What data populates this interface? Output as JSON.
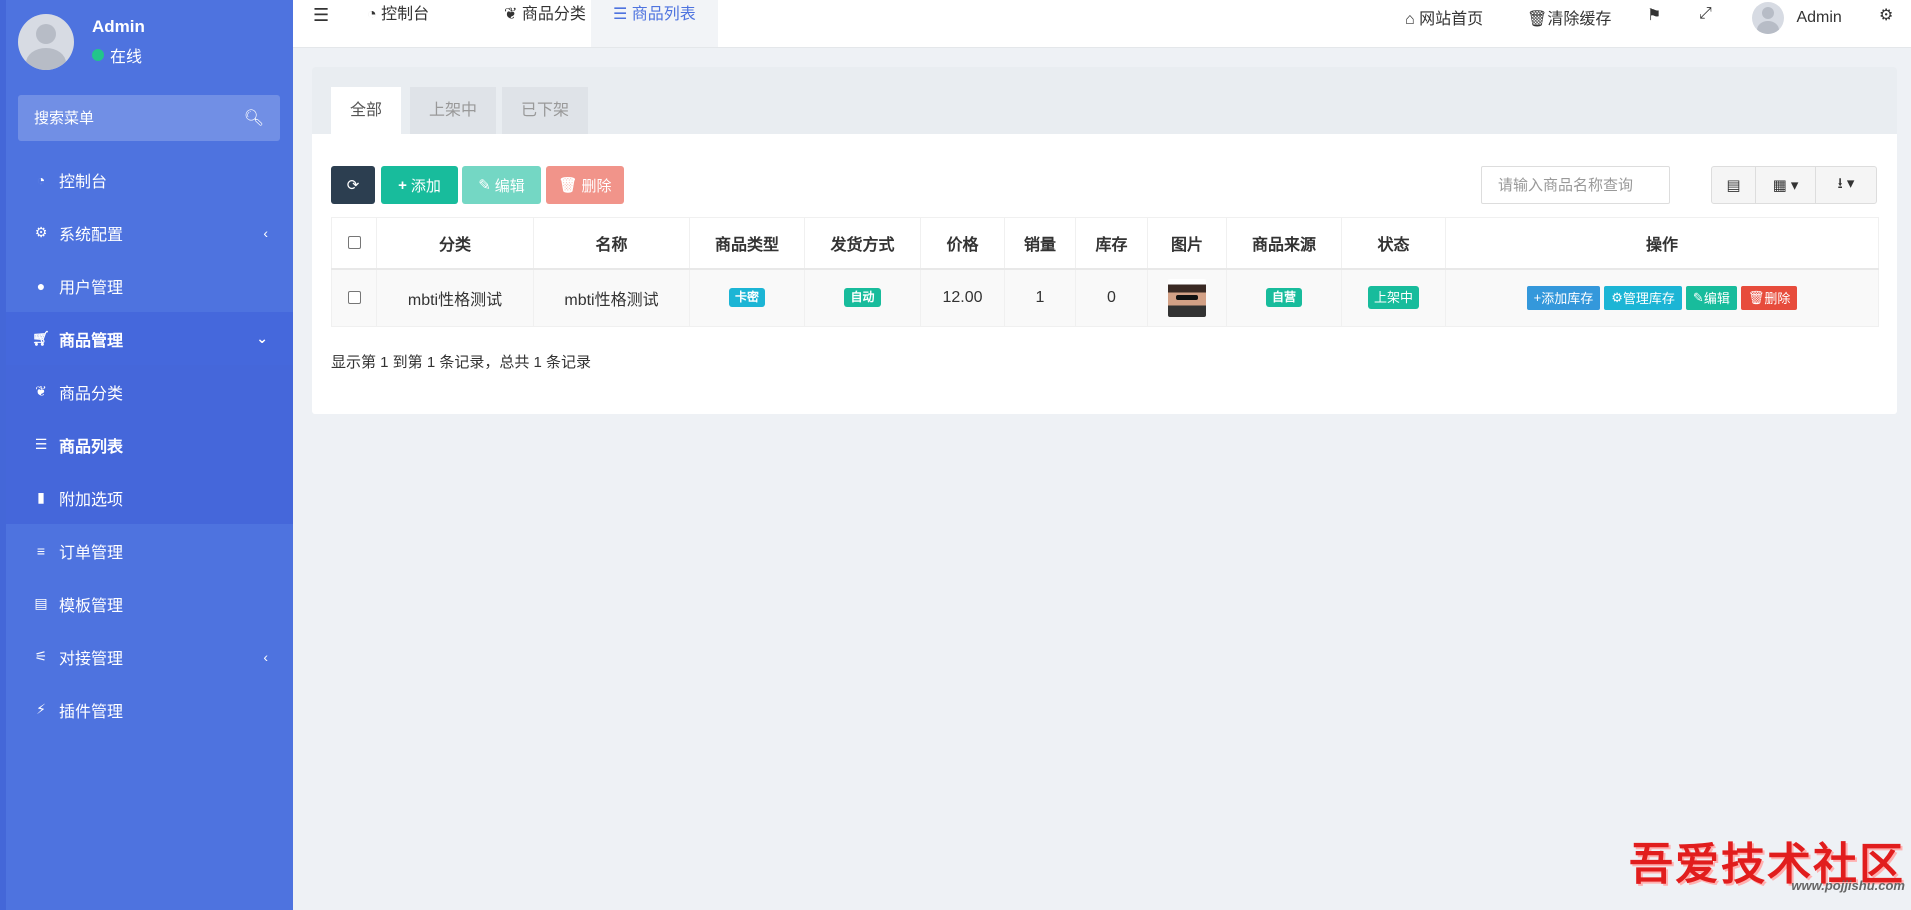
{
  "sidebar": {
    "user": {
      "name": "Admin",
      "status": "在线"
    },
    "search_placeholder": "搜索菜单",
    "items": [
      {
        "icon": "dashboard-icon",
        "glyph": "⌚",
        "label": "控制台"
      },
      {
        "icon": "gear-icon",
        "glyph": "⚙",
        "label": "系统配置",
        "caret": "‹"
      },
      {
        "icon": "user-icon",
        "glyph": "👤",
        "label": "用户管理"
      },
      {
        "icon": "cart-icon",
        "glyph": "🛒",
        "label": "商品管理",
        "caret": "⌄"
      },
      {
        "icon": "leaf-icon",
        "glyph": "❦",
        "label": "商品分类"
      },
      {
        "icon": "list-icon",
        "glyph": "☰",
        "label": "商品列表"
      },
      {
        "icon": "bookmark-icon",
        "glyph": "🔖",
        "label": "附加选项"
      },
      {
        "icon": "menu-icon",
        "glyph": "≡",
        "label": "订单管理"
      },
      {
        "icon": "template-icon",
        "glyph": "▤",
        "label": "模板管理"
      },
      {
        "icon": "sliders-icon",
        "glyph": "⚟",
        "label": "对接管理",
        "caret": "‹"
      },
      {
        "icon": "plug-icon",
        "glyph": "🔌",
        "label": "插件管理"
      }
    ]
  },
  "header": {
    "tabs": [
      "控制台",
      "商品分类",
      "商品列表"
    ],
    "links": {
      "home": "网站首页",
      "clear_cache": "清除缓存",
      "user": "Admin"
    }
  },
  "panel": {
    "tabs": [
      "全部",
      "上架中",
      "已下架"
    ],
    "toolbar": {
      "add": "添加",
      "edit": "编辑",
      "delete": "删除"
    },
    "search_placeholder": "请输入商品名称查询",
    "columns": [
      "分类",
      "名称",
      "商品类型",
      "发货方式",
      "价格",
      "销量",
      "库存",
      "图片",
      "商品来源",
      "状态",
      "操作"
    ],
    "rows": [
      {
        "category": "mbti性格测试",
        "name": "mbti性格测试",
        "type": "卡密",
        "delivery": "自动",
        "price": "12.00",
        "sales": "1",
        "stock": "0",
        "source": "自营",
        "status": "上架中",
        "ops": [
          "添加库存",
          "管理库存",
          "编辑",
          "删除"
        ]
      }
    ],
    "pagination": "显示第 1 到第 1 条记录，总共 1 条记录"
  },
  "colors": {
    "sidebar": "#4e73df",
    "primary": "#4e73df",
    "success": "#18bc9c",
    "info": "#1cb5d5",
    "danger": "#e74c3c",
    "dark": "#2c3e50",
    "blue": "#3498db"
  },
  "watermark": {
    "text": "吾爱技术社区",
    "url": "www.pojjishu.com"
  }
}
